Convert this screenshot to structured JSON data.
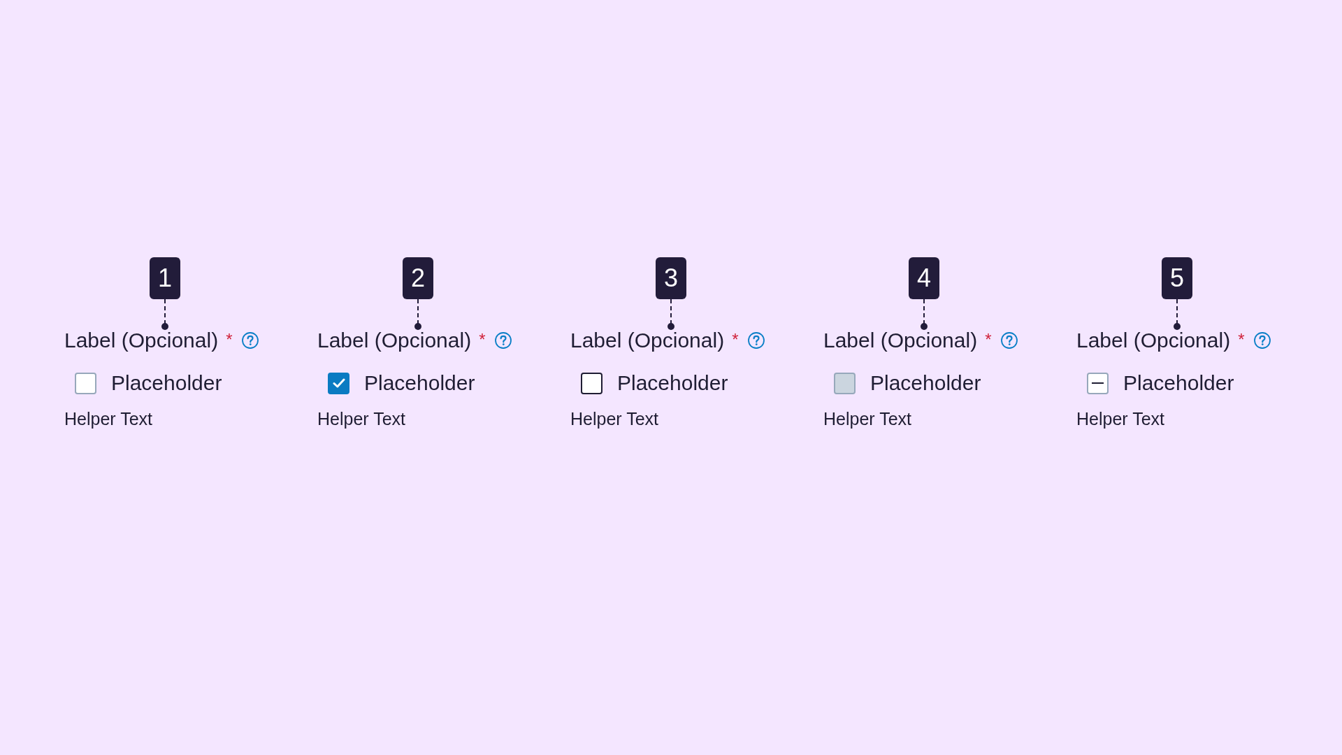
{
  "checkbox_states": [
    {
      "marker": "1",
      "label": "Label (Opcional)",
      "required_mark": "*",
      "option_label": "Placeholder",
      "checked": false,
      "indeterminate": false,
      "disabled": false,
      "hovered": false,
      "helper_text": "Helper Text"
    },
    {
      "marker": "2",
      "label": "Label (Opcional)",
      "required_mark": "*",
      "option_label": "Placeholder",
      "checked": true,
      "indeterminate": false,
      "disabled": false,
      "hovered": false,
      "helper_text": "Helper Text"
    },
    {
      "marker": "3",
      "label": "Label (Opcional)",
      "required_mark": "*",
      "option_label": "Placeholder",
      "checked": false,
      "indeterminate": false,
      "disabled": false,
      "hovered": true,
      "helper_text": "Helper Text"
    },
    {
      "marker": "4",
      "label": "Label (Opcional)",
      "required_mark": "*",
      "option_label": "Placeholder",
      "checked": false,
      "indeterminate": false,
      "disabled": true,
      "hovered": false,
      "helper_text": "Helper Text"
    },
    {
      "marker": "5",
      "label": "Label (Opcional)",
      "required_mark": "*",
      "option_label": "Placeholder",
      "checked": false,
      "indeterminate": true,
      "disabled": false,
      "hovered": false,
      "helper_text": "Helper Text"
    }
  ]
}
